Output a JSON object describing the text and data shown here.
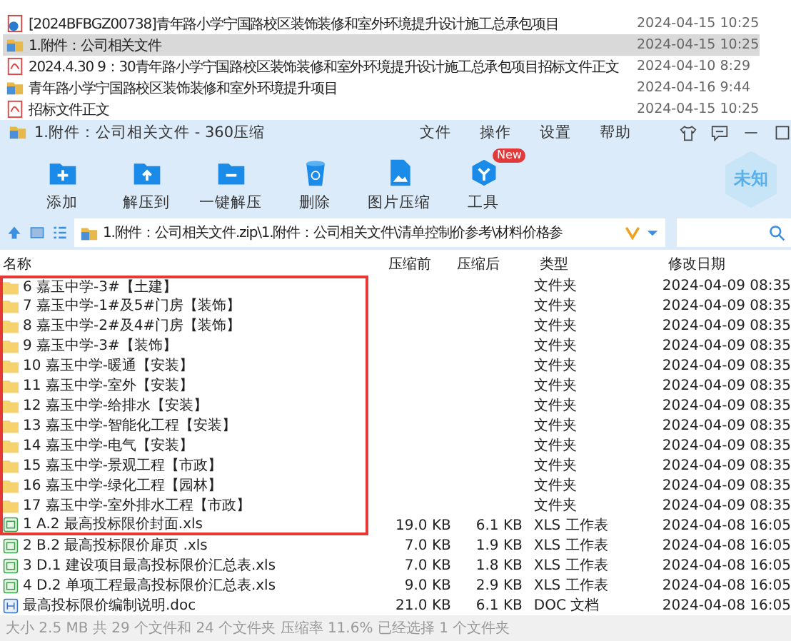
{
  "explorer": {
    "rows": [
      {
        "kind": "web",
        "name": "[2024BFBGZ00738]青年路小学宁国路校区装饰装修和室外环境提升设计施工总承包项目",
        "date": "2024-04-15 10:25",
        "selected": false
      },
      {
        "kind": "folder",
        "name": "1.附件：公司相关文件",
        "date": "2024-04-15 10:25",
        "selected": true
      },
      {
        "kind": "pdf",
        "name": "2024.4.30 9：30青年路小学宁国路校区装饰装修和室外环境提升设计施工总承包项目招标文件正文",
        "date": "2024-04-10 8:29",
        "selected": false
      },
      {
        "kind": "folder",
        "name": "青年路小学宁国路校区装饰装修和室外环境提升项目",
        "date": "2024-04-16 9:44",
        "selected": false
      },
      {
        "kind": "pdf",
        "name": "招标文件正文",
        "date": "2024-04-15 10:25",
        "selected": false
      }
    ]
  },
  "window": {
    "title": "1.附件：公司相关文件 - 360压缩",
    "menu": [
      "文件",
      "操作",
      "设置",
      "帮助"
    ]
  },
  "toolbar": [
    {
      "kind": "add",
      "label": "添加"
    },
    {
      "kind": "extract",
      "label": "解压到"
    },
    {
      "kind": "oneclick",
      "label": "一键解压"
    },
    {
      "kind": "delete",
      "label": "删除"
    },
    {
      "kind": "image",
      "label": "图片压缩"
    },
    {
      "kind": "tools",
      "label": "工具",
      "badge": "New"
    }
  ],
  "rating_badge": "未知",
  "address": {
    "path": "1.附件：公司相关文件.zip\\1.附件：公司相关文件\\清单控制价参考\\材料价格参"
  },
  "columns": [
    "名称",
    "压缩前",
    "压缩后",
    "类型",
    "修改日期"
  ],
  "rows": [
    {
      "kind": "folder",
      "name": "6 嘉玉中学-3#【土建】",
      "before": "",
      "after": "",
      "type": "文件夹",
      "date": "2024-04-09 08:35",
      "marked": true
    },
    {
      "kind": "folder",
      "name": "7 嘉玉中学-1#及5#门房【装饰】",
      "before": "",
      "after": "",
      "type": "文件夹",
      "date": "2024-04-09 08:35",
      "marked": true
    },
    {
      "kind": "folder",
      "name": "8 嘉玉中学-2#及4#门房【装饰】",
      "before": "",
      "after": "",
      "type": "文件夹",
      "date": "2024-04-09 08:35",
      "marked": true
    },
    {
      "kind": "folder",
      "name": "9 嘉玉中学-3#【装饰】",
      "before": "",
      "after": "",
      "type": "文件夹",
      "date": "2024-04-09 08:35",
      "marked": true
    },
    {
      "kind": "folder",
      "name": "10 嘉玉中学-暖通【安装】",
      "before": "",
      "after": "",
      "type": "文件夹",
      "date": "2024-04-09 08:35",
      "marked": true
    },
    {
      "kind": "folder",
      "name": "11 嘉玉中学-室外【安装】",
      "before": "",
      "after": "",
      "type": "文件夹",
      "date": "2024-04-09 08:35",
      "marked": true
    },
    {
      "kind": "folder",
      "name": "12 嘉玉中学-给排水【安装】",
      "before": "",
      "after": "",
      "type": "文件夹",
      "date": "2024-04-09 08:35",
      "marked": true
    },
    {
      "kind": "folder",
      "name": "13 嘉玉中学-智能化工程【安装】",
      "before": "",
      "after": "",
      "type": "文件夹",
      "date": "2024-04-09 08:35",
      "marked": true
    },
    {
      "kind": "folder",
      "name": "14 嘉玉中学-电气【安装】",
      "before": "",
      "after": "",
      "type": "文件夹",
      "date": "2024-04-09 08:35",
      "marked": true
    },
    {
      "kind": "folder",
      "name": "15 嘉玉中学-景观工程【市政】",
      "before": "",
      "after": "",
      "type": "文件夹",
      "date": "2024-04-09 08:35",
      "marked": true
    },
    {
      "kind": "folder",
      "name": "16 嘉玉中学-绿化工程【园林】",
      "before": "",
      "after": "",
      "type": "文件夹",
      "date": "2024-04-09 08:35",
      "marked": true
    },
    {
      "kind": "folder",
      "name": "17 嘉玉中学-室外排水工程【市政】",
      "before": "",
      "after": "",
      "type": "文件夹",
      "date": "2024-04-09 08:35",
      "marked": true
    },
    {
      "kind": "xls",
      "name": "1 A.2 最高投标限价封面.xls",
      "before": "19.0 KB",
      "after": "6.1 KB",
      "type": "XLS 工作表",
      "date": "2024-04-08 16:05",
      "marked": true
    },
    {
      "kind": "xls",
      "name": "2 B.2 最高投标限价扉页 .xls",
      "before": "7.0 KB",
      "after": "1.9 KB",
      "type": "XLS 工作表",
      "date": "2024-04-08 16:05",
      "marked": false
    },
    {
      "kind": "xls",
      "name": "3 D.1 建设项目最高投标限价汇总表.xls",
      "before": "7.0 KB",
      "after": "1.8 KB",
      "type": "XLS 工作表",
      "date": "2024-04-08 16:05",
      "marked": false
    },
    {
      "kind": "xls",
      "name": "4 D.2 单项工程最高投标限价汇总表.xls",
      "before": "9.0 KB",
      "after": "2.9 KB",
      "type": "XLS 工作表",
      "date": "2024-04-08 16:05",
      "marked": false
    },
    {
      "kind": "doc",
      "name": "最高投标限价编制说明.doc",
      "before": "21.0 KB",
      "after": "6.1 KB",
      "type": "DOC 文档",
      "date": "2024-04-08 16:05",
      "marked": false
    }
  ],
  "status_bar": "大小 2.5 MB 共 29 个文件和 24 个文件夹 压缩率 11.6% 已经选择 1 个文件夹"
}
